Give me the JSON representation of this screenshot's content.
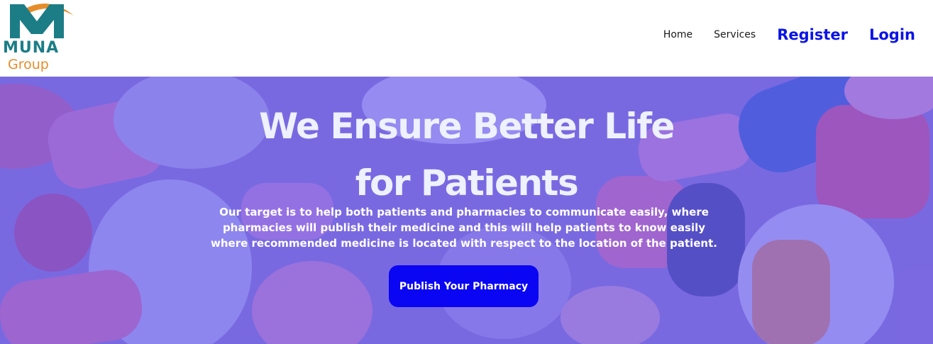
{
  "brand": {
    "name": "MUNA",
    "subname": "Group",
    "colors": {
      "teal": "#1c7d86",
      "orange": "#e58d2a"
    }
  },
  "nav": {
    "items": [
      {
        "label": "Home"
      },
      {
        "label": "Services"
      }
    ],
    "register_label": "Register",
    "login_label": "Login",
    "accent": "#0a14e6"
  },
  "hero": {
    "title_line1": "We Ensure Better Life",
    "title_line2": "for Patients",
    "description": "Our target is to help both patients and pharmacies to communicate easily, where pharmacies will publish their medicine and this will help patients to know easily where recommended medicine is located with respect to the location of the patient.",
    "cta_label": "Publish Your Pharmacy",
    "overlay_color": "#6c5ce6",
    "button_color": "#0a05f2",
    "background_image": "pills-photo"
  }
}
